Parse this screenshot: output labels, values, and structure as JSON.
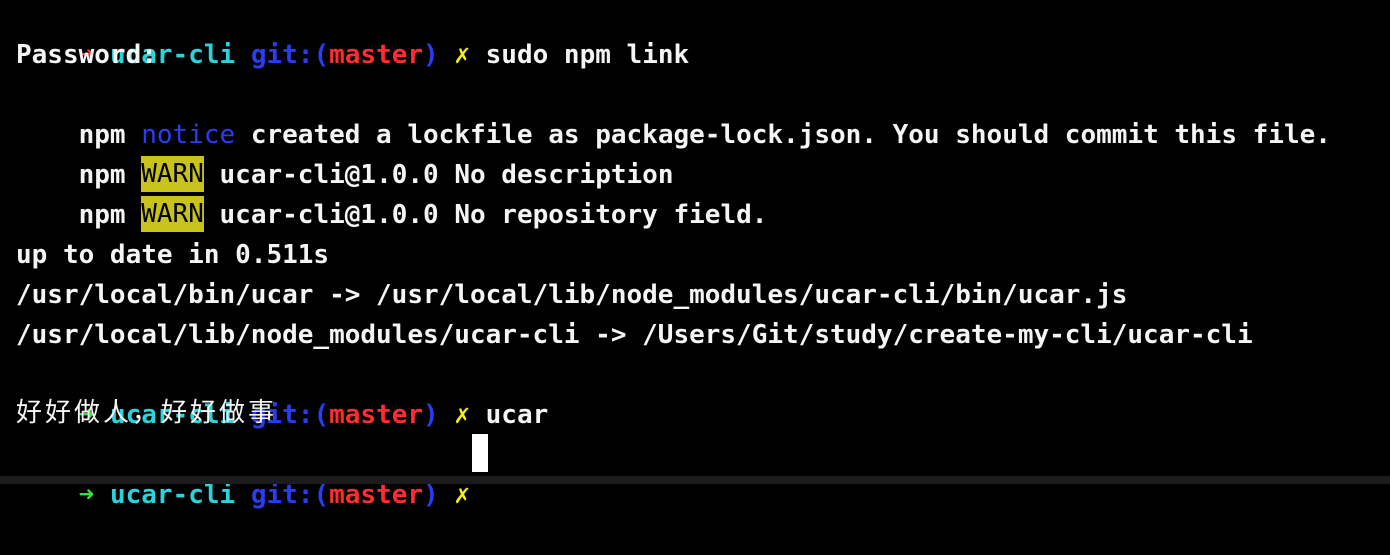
{
  "terminal": {
    "colors": {
      "background": "#000000",
      "text": "#f5f5f5",
      "prompt_arrow_error": "#ff2d2d",
      "prompt_arrow_ok": "#3be03b",
      "directory": "#2ad4dc",
      "git": "#2b3cf5",
      "branch": "#ff2d2d",
      "dirty_mark": "#f2ef1a",
      "warn_background": "#c7c21c"
    },
    "prompt": {
      "arrow": "➜",
      "dir": "ucar-cli",
      "git_label": "git:(",
      "branch": "master",
      "git_close": ")",
      "dirty": "✗"
    },
    "line0": {
      "command": "sudo npm link"
    },
    "line1": {
      "text": "Password:"
    },
    "line2": {
      "npm": "npm",
      "level": "notice",
      "message": "created a lockfile as package-lock.json. You should commit this file."
    },
    "line3": {
      "npm": "npm",
      "level": "WARN",
      "message": "ucar-cli@1.0.0 No description"
    },
    "line4": {
      "npm": "npm",
      "level": "WARN",
      "message": "ucar-cli@1.0.0 No repository field."
    },
    "line6": {
      "text": "up to date in 0.511s"
    },
    "line7": {
      "text": "/usr/local/bin/ucar -> /usr/local/lib/node_modules/ucar-cli/bin/ucar.js"
    },
    "line8": {
      "text": "/usr/local/lib/node_modules/ucar-cli -> /Users/Git/study/create-my-cli/ucar-cli"
    },
    "line9": {
      "command": "ucar"
    },
    "line10": {
      "text": "好好做人，好好做事"
    },
    "line11": {
      "command": ""
    }
  }
}
